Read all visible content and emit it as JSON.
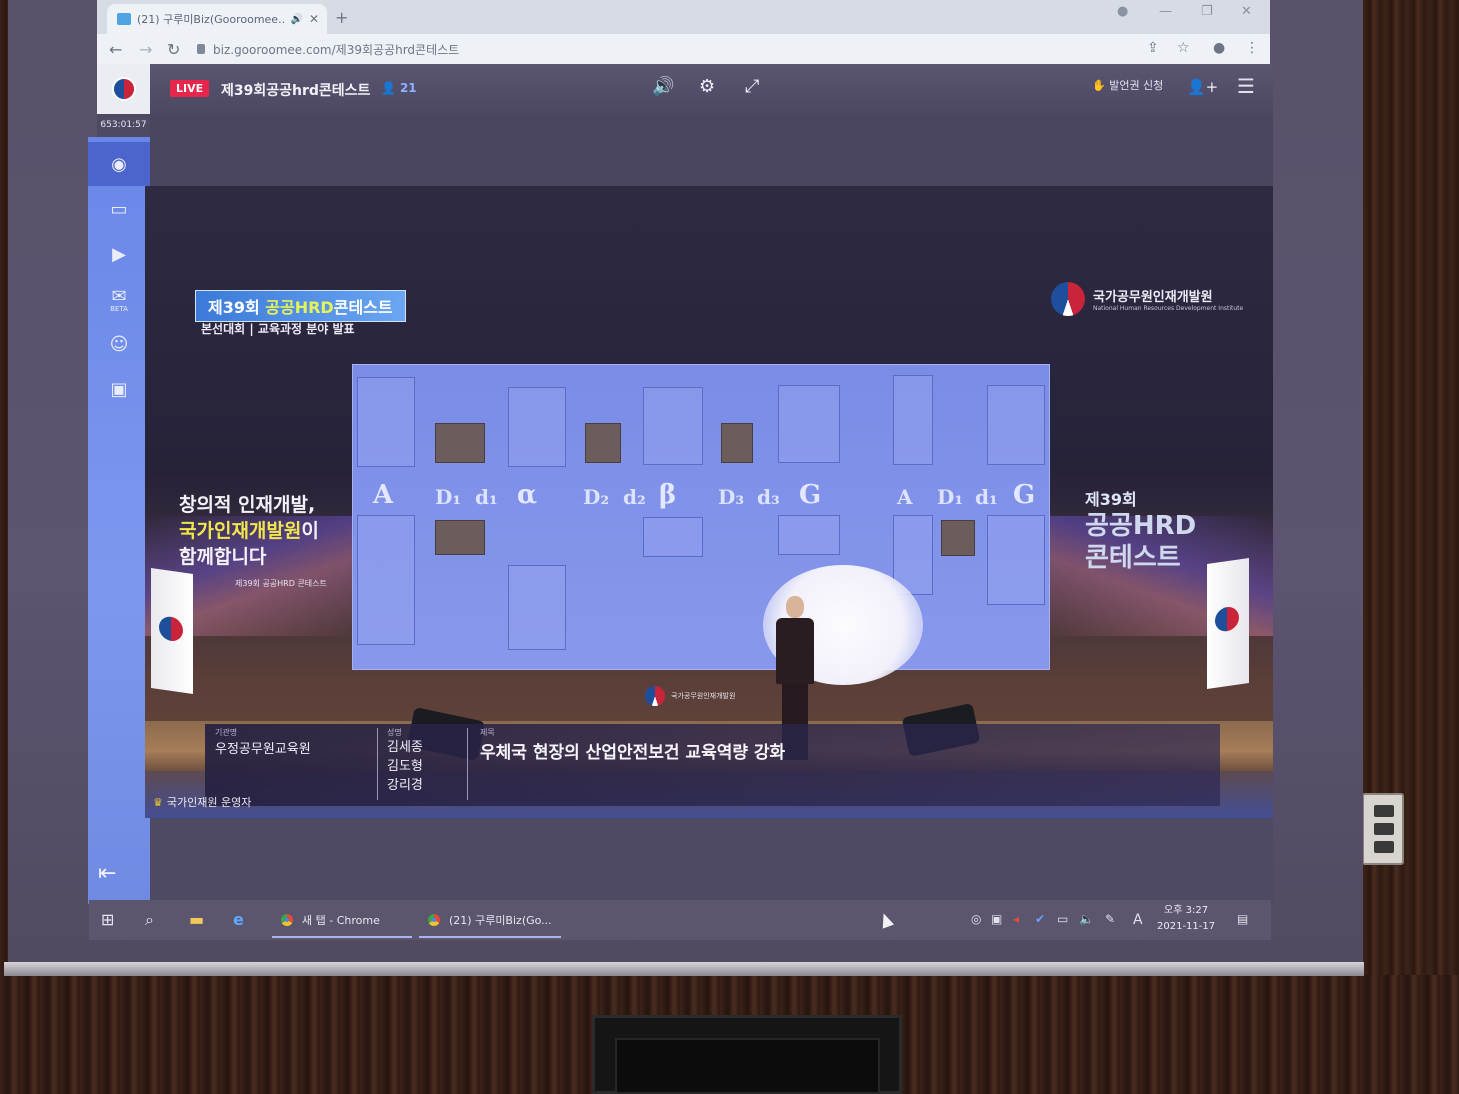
{
  "browser": {
    "tab_title": "(21) 구루미Biz(Gooroomee...",
    "tab_close": "✕",
    "new_tab": "+",
    "url": "biz.gooroomee.com/제39회공공hrd콘테스트"
  },
  "app": {
    "live_label": "LIVE",
    "room_title": "제39회공공hrd콘테스트",
    "viewer_count": "21",
    "speak_request": "발언권 신청",
    "timer": "653:01:57",
    "sidebar_beta": "BETA"
  },
  "video": {
    "badge_prefix": "제39회 ",
    "badge_highlight": "공공HRD",
    "badge_suffix": "콘테스트",
    "subtitle": "본선대회 | 교육과정 분야 발표",
    "org_name_kr": "국가공무원인재개발원",
    "org_name_en": "National Human Resources Development Institute",
    "slogan_line1": "창의적 인재개발,",
    "slogan_line2_highlight": "국가인재개발원",
    "slogan_line2_suffix": "이",
    "slogan_line3": "함께합니다",
    "slogan_small": "제39회 공공HRD 콘테스트",
    "right_no": "제39회",
    "right_line1": "공공HRD",
    "right_line2": "콘테스트",
    "slide_symbols": [
      "A",
      "D₁",
      "d₁",
      "α",
      "D₂",
      "d₂",
      "β",
      "D₃",
      "d₃",
      "G",
      "A",
      "D₁",
      "d₁",
      "G"
    ],
    "stage_logo": "국가공무원인재개발원",
    "caption": {
      "org_label": "기관명",
      "org": "우정공무원교육원",
      "names_label": "성명",
      "names": [
        "김세종",
        "김도형",
        "강리경"
      ],
      "topic_label": "제목",
      "topic": "우체국 현장의 산업안전보건 교육역량 강화"
    },
    "operator": "국가인재원 운영자"
  },
  "taskbar": {
    "app1": "새 탭 - Chrome",
    "app2": "(21) 구루미Biz(Go...",
    "time": "오후 3:27",
    "date": "2021-11-17",
    "ime": "A"
  },
  "colors": {
    "live": "#e6264a",
    "sidebar": "#7690ea",
    "highlight": "#f2e74a"
  }
}
